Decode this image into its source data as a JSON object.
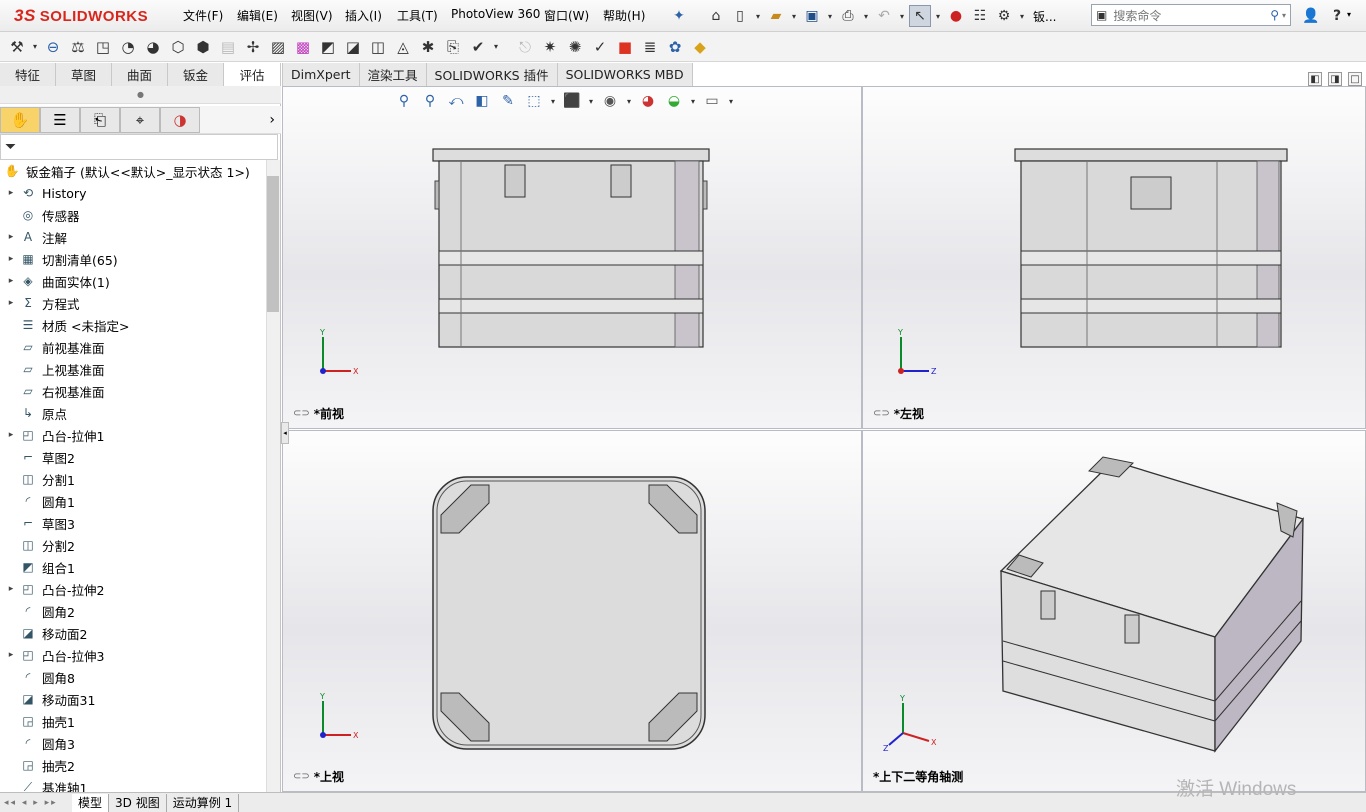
{
  "app": {
    "logo_prefix": "3S",
    "logo": "SOLIDWORKS"
  },
  "menus": [
    "文件(F)",
    "编辑(E)",
    "视图(V)",
    "插入(I)",
    "工具(T)",
    "PhotoView 360",
    "窗口(W)",
    "帮助(H)"
  ],
  "quick_access": {
    "doc_truncated": "钣...",
    "search_placeholder": "搜索命令"
  },
  "command_tabs": [
    "特征",
    "草图",
    "曲面",
    "钣金",
    "评估",
    "DimXpert",
    "渲染工具",
    "SOLIDWORKS 插件",
    "SOLIDWORKS MBD"
  ],
  "active_command_tab": "评估",
  "panel_tabs": [
    "feature-manager",
    "property-manager",
    "configuration-manager",
    "dimxpert-manager",
    "display-manager"
  ],
  "tree": {
    "root": "钣金箱子  (默认<<默认>_显示状态 1>)",
    "items": [
      {
        "label": "History",
        "icon": "history-icon",
        "expand": true
      },
      {
        "label": "传感器",
        "icon": "sensor-icon",
        "expand": false
      },
      {
        "label": "注解",
        "icon": "annotation-icon",
        "expand": true
      },
      {
        "label": "切割清单(65)",
        "icon": "cutlist-icon",
        "expand": true
      },
      {
        "label": "曲面实体(1)",
        "icon": "surface-body-icon",
        "expand": true
      },
      {
        "label": "方程式",
        "icon": "equation-icon",
        "expand": true
      },
      {
        "label": "材质 <未指定>",
        "icon": "material-icon",
        "expand": false
      },
      {
        "label": "前视基准面",
        "icon": "plane-icon",
        "expand": false
      },
      {
        "label": "上视基准面",
        "icon": "plane-icon",
        "expand": false
      },
      {
        "label": "右视基准面",
        "icon": "plane-icon",
        "expand": false
      },
      {
        "label": "原点",
        "icon": "origin-icon",
        "expand": false
      },
      {
        "label": "凸台-拉伸1",
        "icon": "extrude-icon",
        "expand": true
      },
      {
        "label": "草图2",
        "icon": "sketch-icon",
        "expand": false
      },
      {
        "label": "分割1",
        "icon": "split-icon",
        "expand": false
      },
      {
        "label": "圆角1",
        "icon": "fillet-icon",
        "expand": false
      },
      {
        "label": "草图3",
        "icon": "sketch-icon",
        "expand": false
      },
      {
        "label": "分割2",
        "icon": "split-icon",
        "expand": false
      },
      {
        "label": "组合1",
        "icon": "combine-icon",
        "expand": false
      },
      {
        "label": "凸台-拉伸2",
        "icon": "extrude-icon",
        "expand": true
      },
      {
        "label": "圆角2",
        "icon": "fillet-icon",
        "expand": false
      },
      {
        "label": "移动面2",
        "icon": "move-face-icon",
        "expand": false
      },
      {
        "label": "凸台-拉伸3",
        "icon": "extrude-icon",
        "expand": true
      },
      {
        "label": "圆角8",
        "icon": "fillet-icon",
        "expand": false
      },
      {
        "label": "移动面31",
        "icon": "move-face-icon",
        "expand": false
      },
      {
        "label": "抽壳1",
        "icon": "shell-icon",
        "expand": false
      },
      {
        "label": "圆角3",
        "icon": "fillet-icon",
        "expand": false
      },
      {
        "label": "抽壳2",
        "icon": "shell-icon",
        "expand": false
      },
      {
        "label": "基准轴1",
        "icon": "axis-icon",
        "expand": false
      }
    ]
  },
  "viewports": [
    {
      "label": "*前视",
      "triad": [
        "Y",
        "X"
      ]
    },
    {
      "label": "*左视",
      "triad": [
        "Y",
        "Z"
      ]
    },
    {
      "label": "*上视",
      "triad": [
        "Y",
        "X"
      ]
    },
    {
      "label": "*上下二等角轴测",
      "triad": [
        "Y",
        "X",
        "Z"
      ]
    }
  ],
  "bottom_tabs": [
    "模型",
    "3D 视图",
    "运动算例 1"
  ],
  "watermark": "激活 Windows",
  "colors": {
    "logo_red": "#d9261c",
    "active_tab": "#f7d36a"
  }
}
